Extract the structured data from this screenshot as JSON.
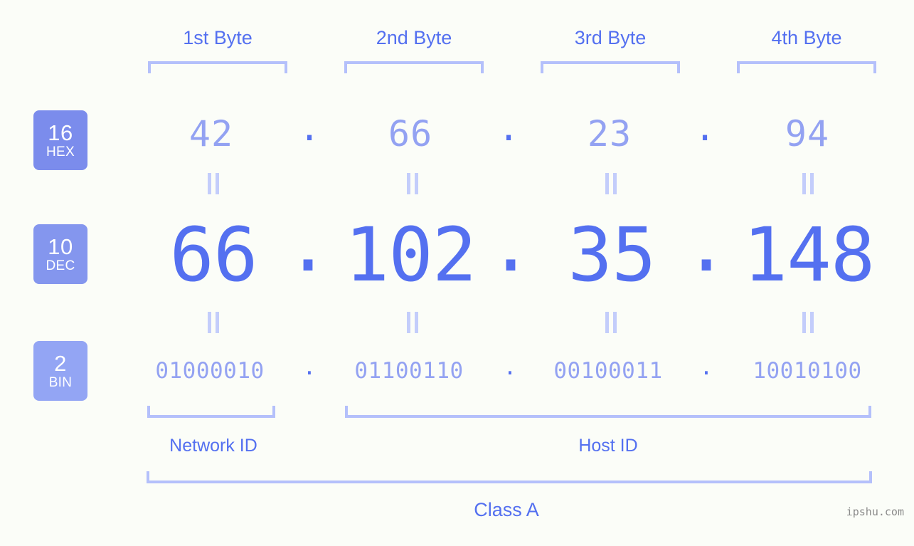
{
  "meta": {
    "watermark": "ipshu.com",
    "background_color": "#fbfdf8",
    "accent_color": "#5470f0",
    "muted_accent_color": "#93a2f2",
    "bracket_color": "#b4c0fb"
  },
  "byte_headers": [
    {
      "label": "1st Byte"
    },
    {
      "label": "2nd Byte"
    },
    {
      "label": "3rd Byte"
    },
    {
      "label": "4th Byte"
    }
  ],
  "bases": [
    {
      "number": "16",
      "system": "HEX",
      "color": "#7b8cec"
    },
    {
      "number": "10",
      "system": "DEC",
      "color": "#8496ee"
    },
    {
      "number": "2",
      "system": "BIN",
      "color": "#93a5f4"
    }
  ],
  "separators": {
    "dot": ".",
    "equals_symbol": "="
  },
  "rows": {
    "hex": {
      "base_number": "16",
      "base_system": "HEX",
      "values": [
        "42",
        "66",
        "23",
        "94"
      ]
    },
    "dec": {
      "base_number": "10",
      "base_system": "DEC",
      "values": [
        "66",
        "102",
        "35",
        "148"
      ]
    },
    "bin": {
      "base_number": "2",
      "base_system": "BIN",
      "values": [
        "01000010",
        "01100110",
        "00100011",
        "10010100"
      ]
    }
  },
  "segments": {
    "network_id": "Network ID",
    "host_id": "Host ID",
    "ip_class": "Class A"
  },
  "address": {
    "decimal": "66.102.35.148",
    "hexadecimal": "42.66.23.94",
    "binary": "01000010.01100110.00100011.10010100"
  }
}
